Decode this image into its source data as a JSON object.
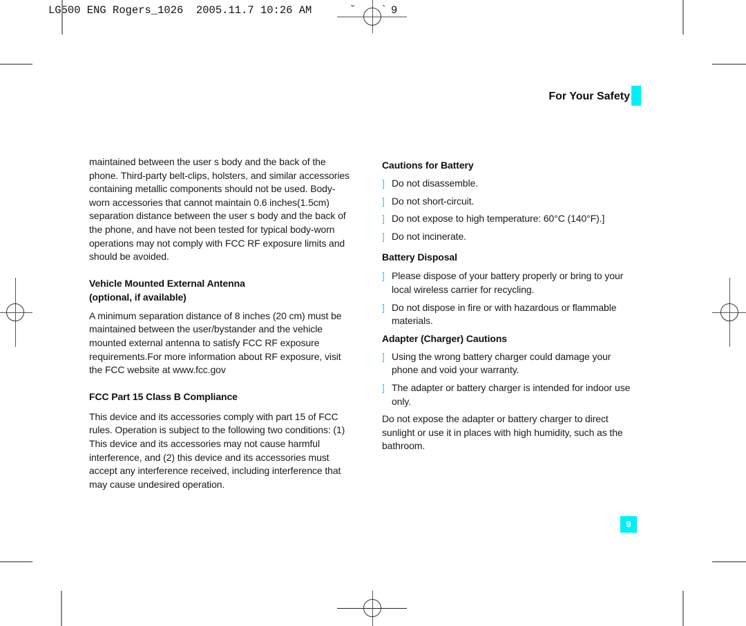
{
  "slug": {
    "text": "LG500 ENG Rogers_1026  2005.11.7 10:26 AM",
    "marks_left": "˘",
    "marks_right": "`",
    "page_ref": "9"
  },
  "header": {
    "section_title": "For Your Safety",
    "accent_color": "#00f0f8"
  },
  "left_column": {
    "intro_paragraph": "maintained between the user s body and the back of the phone. Third-party belt-clips, holsters, and similar accessories containing metallic components should not be used. Body-worn accessories that  cannot maintain 0.6 inches(1.5cm) separation distance between the user s body and the back of the phone, and have not been tested for typical body-worn operations may not comply with FCC RF exposure limits and should be avoided.",
    "vehicle_heading_line1": "Vehicle Mounted External Antenna",
    "vehicle_heading_line2": "(optional, if available)",
    "vehicle_paragraph": "A minimum separation distance of 8 inches (20 cm) must be maintained between the user/bystander and the vehicle mounted external antenna to satisfy FCC RF exposure requirements.For more information about RF exposure, visit the FCC website at www.fcc.gov",
    "fcc_heading": "FCC Part 15 Class B Compliance",
    "fcc_paragraph": "This device and its accessories comply with part 15 of FCC rules. Operation is subject to the following two conditions: (1) This device and its accessories may not cause harmful interference, and (2) this device and its accessories must accept any interference received, including interference that may cause undesired operation."
  },
  "right_column": {
    "battery_cautions": {
      "heading": "Cautions for Battery",
      "items": [
        "Do not disassemble.",
        "Do not short-circuit.",
        "Do not expose to high temperature: 60°C (140°F).]",
        "Do not incinerate."
      ]
    },
    "battery_disposal": {
      "heading": "Battery Disposal",
      "items": [
        "Please dispose of your battery properly or bring to your local wireless carrier for recycling.",
        "Do not dispose in fire or with hazardous or flammable materials."
      ]
    },
    "adapter_cautions": {
      "heading": "Adapter (Charger) Cautions",
      "items": [
        "Using the wrong battery charger could damage your phone and void your warranty.",
        "The adapter or battery charger is intended for indoor use only."
      ],
      "closing_paragraph": "Do not expose the adapter or battery charger to direct sunlight or use it in places with high humidity, such as the bathroom."
    },
    "bullet_glyph": "]",
    "bullet_color": "#19d6e6"
  },
  "footer": {
    "page_number": "9"
  }
}
